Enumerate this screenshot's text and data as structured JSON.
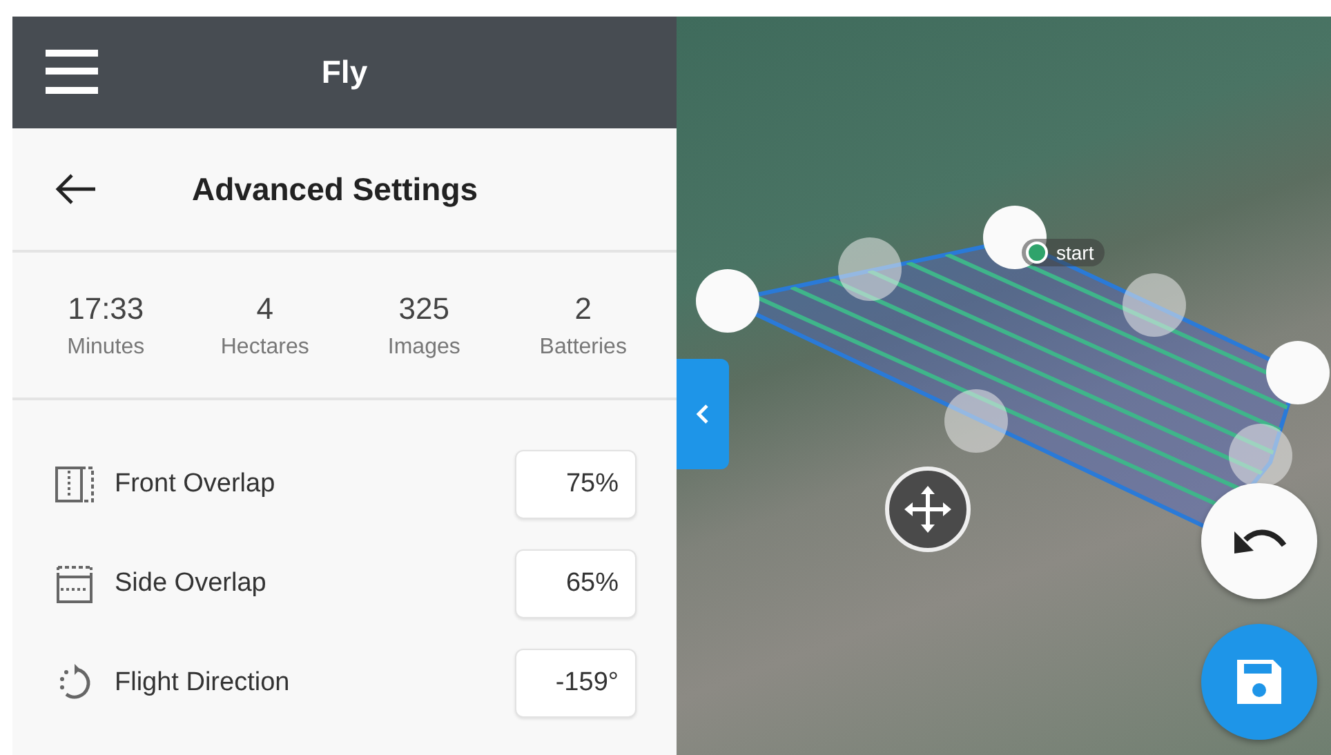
{
  "header": {
    "title": "Fly"
  },
  "subheader": {
    "title": "Advanced Settings"
  },
  "stats": [
    {
      "value": "17:33",
      "label": "Minutes"
    },
    {
      "value": "4",
      "label": "Hectares"
    },
    {
      "value": "325",
      "label": "Images"
    },
    {
      "value": "2",
      "label": "Batteries"
    }
  ],
  "settings": [
    {
      "kind": "front_overlap",
      "label": "Front Overlap",
      "value": "75%"
    },
    {
      "kind": "side_overlap",
      "label": "Side Overlap",
      "value": "65%"
    },
    {
      "kind": "direction",
      "label": "Flight Direction",
      "value": "-159°"
    }
  ],
  "map": {
    "start_label": "start"
  }
}
